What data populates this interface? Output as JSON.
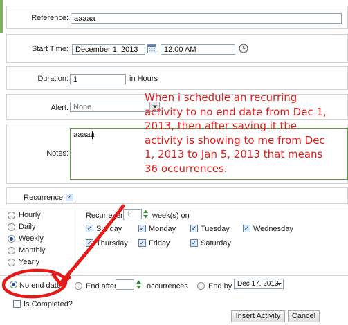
{
  "form": {
    "reference_label": "Reference:",
    "reference_value": "aaaaa",
    "start_time_label": "Start Time:",
    "start_date_value": "December 1, 2013",
    "start_time_value": "12:00 AM",
    "duration_label": "Duration:",
    "duration_value": "1",
    "duration_unit": "in Hours",
    "alert_label": "Alert:",
    "alert_value": "None",
    "notes_label": "Notes:",
    "notes_value": "aaaaa",
    "recurrence_label": "Recurrence",
    "recurrence_checked": true
  },
  "recurrence": {
    "patterns": [
      {
        "label": "Hourly",
        "selected": false
      },
      {
        "label": "Daily",
        "selected": false
      },
      {
        "label": "Weekly",
        "selected": true
      },
      {
        "label": "Monthly",
        "selected": false
      },
      {
        "label": "Yearly",
        "selected": false
      }
    ],
    "recur_prefix": "Recur every",
    "recur_value": "1",
    "recur_suffix": "week(s) on",
    "days": [
      {
        "label": "Sunday",
        "checked": true
      },
      {
        "label": "Monday",
        "checked": true
      },
      {
        "label": "Tuesday",
        "checked": true
      },
      {
        "label": "Wednesday",
        "checked": true
      },
      {
        "label": "Thursday",
        "checked": true
      },
      {
        "label": "Friday",
        "checked": true
      },
      {
        "label": "Saturday",
        "checked": true
      }
    ],
    "end_options": {
      "no_end_label": "No end date",
      "end_after_label": "End after",
      "end_after_value": "",
      "occurrences_label": "occurrences",
      "end_by_label": "End by",
      "end_by_value": "Dec 17, 2013"
    }
  },
  "completed_label": "Is Completed?",
  "buttons": {
    "insert_label": "Insert Activity",
    "cancel_label": "Cancel"
  },
  "annotation": {
    "lines": [
      "When i schedule an recurring",
      "activity to no end date from Dec 1,",
      "2013, then after saving it the",
      "activity is showing to me from Dec",
      "1, 2013 to Jan 5, 2013 that means",
      "36 occurrences."
    ],
    "color": "#e31b1b"
  },
  "colors": {
    "accent_green": "#7fb05a",
    "field_border": "#8fa3b3",
    "notes_border": "#5ea040"
  }
}
